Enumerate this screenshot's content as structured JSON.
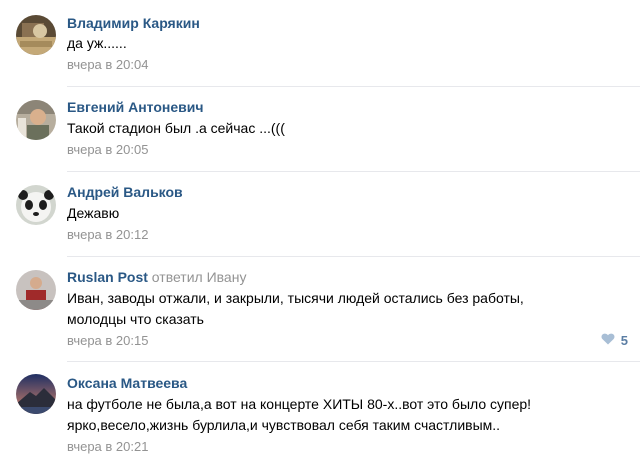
{
  "comments": [
    {
      "author": "Владимир Карякин",
      "text_lines": [
        "да уж......"
      ],
      "date": "вчера в 20:04"
    },
    {
      "author": "Евгений Антоневич",
      "text_lines": [
        "Такой стадион был .а сейчас ...((("
      ],
      "date": "вчера в 20:05"
    },
    {
      "author": "Андрей Вальков",
      "text_lines": [
        "Дежавю"
      ],
      "date": "вчера в 20:12"
    },
    {
      "author": "Ruslan Post",
      "reply_prefix": "ответил",
      "reply_target": "Ивану",
      "text_lines": [
        "Иван, заводы отжали, и закрыли, тысячи людей остались без работы,",
        "молодцы что сказать"
      ],
      "date": "вчера в 20:15",
      "likes": "5"
    },
    {
      "author": "Оксана Матвеева",
      "text_lines": [
        "на футболе не была,а вот на концерте ХИТЫ 80-х..вот это было супер!",
        "ярко,весело,жизнь бурлила,и чувствовал себя таким счастливым.."
      ],
      "date": "вчера в 20:21"
    }
  ],
  "colors": {
    "author_link": "#2a5885",
    "meta_gray": "#939393",
    "like_blue": "#5b7ea4",
    "divider": "#e7e8ec"
  },
  "icons": {
    "like": "heart-icon"
  }
}
